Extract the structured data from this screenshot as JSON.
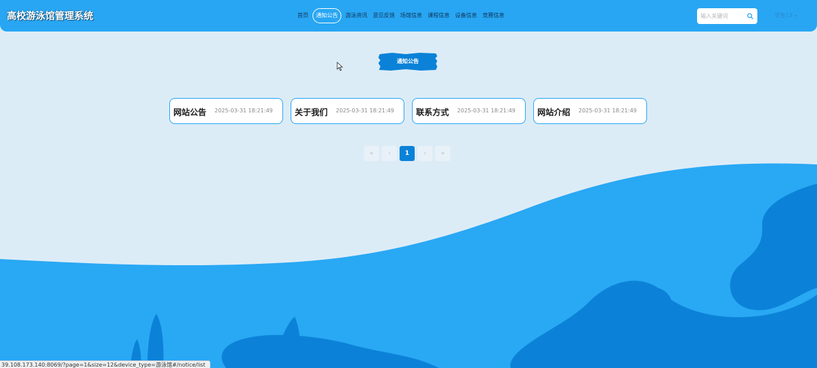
{
  "header": {
    "site_title": "高校游泳馆管理系统",
    "nav": [
      {
        "label": "首页",
        "active": false
      },
      {
        "label": "通知公告",
        "active": true
      },
      {
        "label": "游泳资讯",
        "active": false
      },
      {
        "label": "意见反馈",
        "active": false
      },
      {
        "label": "场馆信息",
        "active": false
      },
      {
        "label": "课程信息",
        "active": false
      },
      {
        "label": "设备信息",
        "active": false
      },
      {
        "label": "竞赛信息",
        "active": false
      }
    ],
    "search_placeholder": "输入关键词",
    "user_label": "学生13"
  },
  "section_title": "通知公告",
  "cards": [
    {
      "title": "网站公告",
      "date": "2025-03-31 18:21:49"
    },
    {
      "title": "关于我们",
      "date": "2025-03-31 18:21:49"
    },
    {
      "title": "联系方式",
      "date": "2025-03-31 18:21:49"
    },
    {
      "title": "网站介绍",
      "date": "2025-03-31 18:21:49"
    }
  ],
  "pager": {
    "first": "«",
    "prev": "‹",
    "current": "1",
    "next": "›",
    "last": "»"
  },
  "status_bar_url": "39.108.173.140:8069/?page=1&size=12&device_type=游泳馆#/notice/list",
  "colors": {
    "header": "#28a6f3",
    "accent": "#0b82d8",
    "background": "#dcecf7",
    "wave_light": "#29a8f4",
    "wave_dark": "#0b82d8"
  }
}
